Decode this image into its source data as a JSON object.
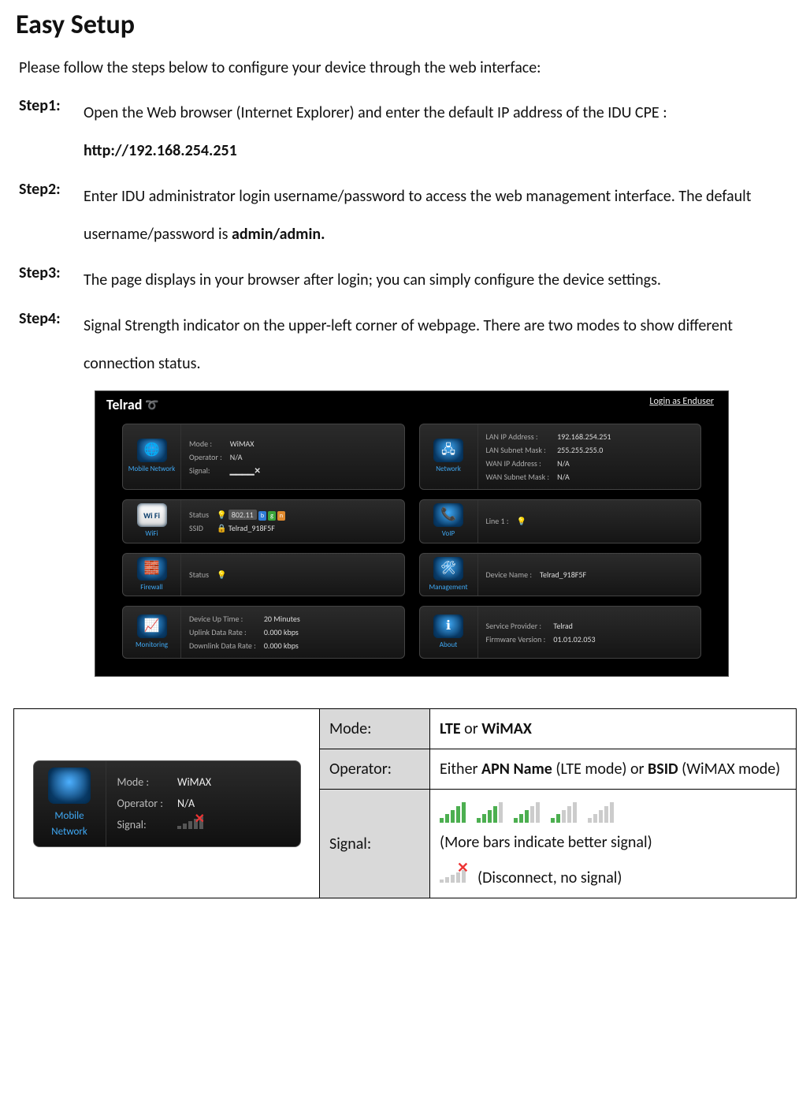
{
  "title": "Easy Setup",
  "intro": "Please follow the steps below to configure your device through the web interface:",
  "steps": [
    {
      "label": "Step1:",
      "text_a": "Open the Web browser (Internet Explorer) and enter the default IP address of the IDU CPE : ",
      "bold_a": "http://192.168.254.251"
    },
    {
      "label": "Step2:",
      "text_a": "Enter IDU administrator login username/password to access the web management interface. The default username/password is ",
      "bold_a": "admin/admin."
    },
    {
      "label": "Step3:",
      "text_a": "The page displays in your browser after login; you can simply configure the device settings.",
      "bold_a": ""
    },
    {
      "label": "Step4:",
      "text_a": "Signal Strength indicator on the upper-left corner of webpage. There are two modes to show different connection status.",
      "bold_a": ""
    }
  ],
  "dashboard": {
    "brand": "Telrad",
    "login_link": "Login as Enduser",
    "mobile_network": {
      "label": "Mobile Network",
      "mode_k": "Mode :",
      "mode_v": "WiMAX",
      "operator_k": "Operator :",
      "operator_v": "N/A",
      "signal_k": "Signal:",
      "signal_v": "✕"
    },
    "network": {
      "label": "Network",
      "lan_ip_k": "LAN IP Address :",
      "lan_ip_v": "192.168.254.251",
      "lan_mask_k": "LAN Subnet Mask :",
      "lan_mask_v": "255.255.255.0",
      "wan_ip_k": "WAN IP Address :",
      "wan_ip_v": "N/A",
      "wan_mask_k": "WAN Subnet Mask :",
      "wan_mask_v": "N/A"
    },
    "wifi": {
      "label": "WiFi",
      "status_k": "Status",
      "std": "802.11",
      "ssid_k": "SSID",
      "ssid_v": "Telrad_918F5F"
    },
    "voip": {
      "label": "VoIP",
      "line_k": "Line 1 :"
    },
    "firewall": {
      "label": "Firewall",
      "status_k": "Status"
    },
    "management": {
      "label": "Management",
      "name_k": "Device Name :",
      "name_v": "Telrad_918F5F"
    },
    "monitoring": {
      "label": "Monitoring",
      "uptime_k": "Device Up Time :",
      "uptime_v": "20 Minutes",
      "ul_k": "Uplink Data Rate :",
      "ul_v": "0.000  kbps",
      "dl_k": "Downlink Data Rate :",
      "dl_v": "0.000  kbps"
    },
    "about": {
      "label": "About",
      "sp_k": "Service Provider :",
      "sp_v": "Telrad",
      "fw_k": "Firmware Version :",
      "fw_v": "01.01.02.053"
    }
  },
  "mini": {
    "label": "Mobile Network",
    "mode_k": "Mode :",
    "mode_v": "WiMAX",
    "operator_k": "Operator :",
    "operator_v": "N/A",
    "signal_k": "Signal:"
  },
  "table": {
    "mode_k": "Mode:",
    "mode_v_pre": "",
    "mode_v_b1": "LTE",
    "mode_v_mid": " or ",
    "mode_v_b2": "WiMAX",
    "operator_k": "Operator:",
    "operator_v_pre": "Either ",
    "operator_v_b1": "APN Name",
    "operator_v_mid1": " (LTE mode) or ",
    "operator_v_b2": "BSID",
    "operator_v_post": " (WiMAX mode)",
    "signal_k": "Signal:",
    "signal_more": "(More bars indicate better signal)",
    "signal_disc": "(Disconnect, no signal)"
  }
}
